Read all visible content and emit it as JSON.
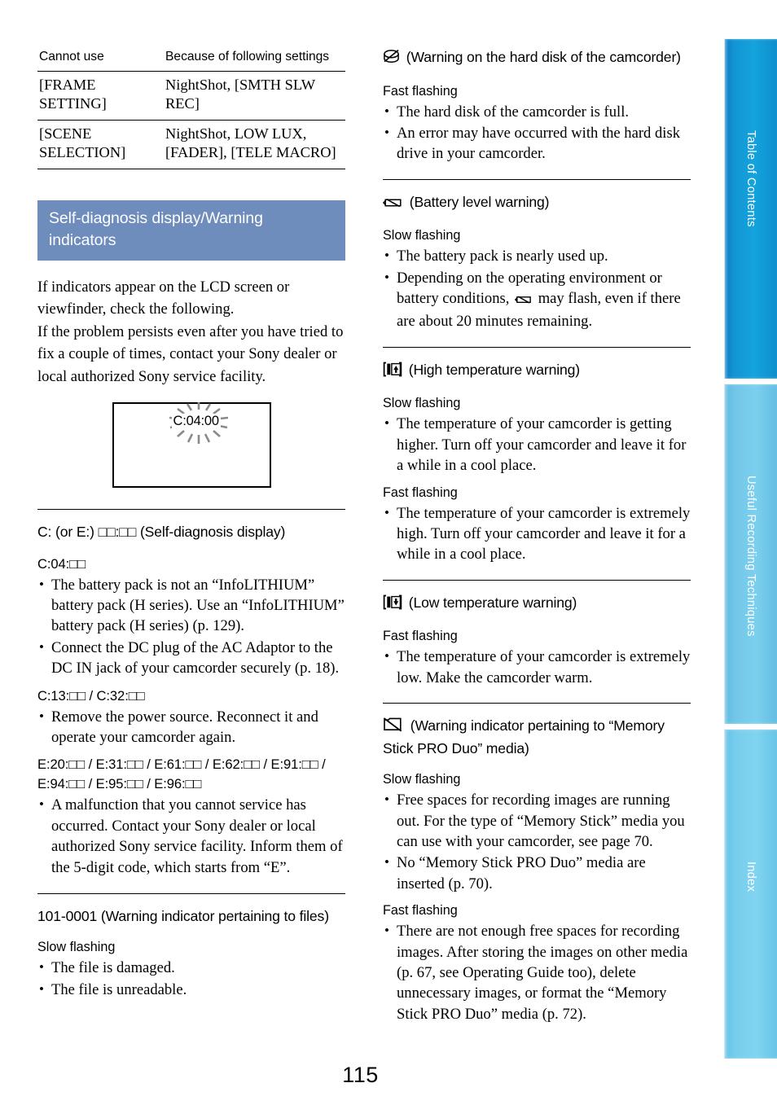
{
  "page": {
    "number": "115"
  },
  "settings_table": {
    "headers": [
      "Cannot use",
      "Because of following settings"
    ],
    "rows": [
      {
        "cannot_use": "[FRAME SETTING]",
        "because": "NightShot, [SMTH SLW REC]"
      },
      {
        "cannot_use": "[SCENE SELECTION]",
        "because": "NightShot, LOW LUX, [FADER], [TELE MACRO]"
      }
    ]
  },
  "section": {
    "title": "Self-diagnosis display/Warning indicators",
    "title_color": "#6e8cbc",
    "intro": [
      "If indicators appear on the LCD screen or viewfinder, check the following.",
      "If the problem persists even after you have tried to fix a couple of times, contact your Sony dealer or local authorized Sony service facility."
    ]
  },
  "illustration": {
    "name": "lcd-screen-illustration",
    "code_display": "C:04:00"
  },
  "left_entries": [
    {
      "heading": "C: (or E:) □□:□□ (Self-diagnosis display)",
      "groups": [
        {
          "code": "C:04:□□",
          "bullets": [
            "The battery pack is not an “InfoLITHIUM” battery pack (H series). Use an “InfoLITHIUM” battery pack (H series) (p. 129).",
            "Connect the DC plug of the AC Adaptor to the DC IN jack of your camcorder securely (p. 18)."
          ]
        },
        {
          "code": "C:13:□□ / C:32:□□",
          "bullets": [
            "Remove the power source. Reconnect it and operate your camcorder again."
          ]
        },
        {
          "code": "E:20:□□ / E:31:□□ / E:61:□□ / E:62:□□ / E:91:□□ / E:94:□□ / E:95:□□ / E:96:□□",
          "bullets": [
            "A malfunction that you cannot service has occurred. Contact your Sony dealer or local authorized Sony service facility. Inform them of the 5-digit code, which starts from “E”."
          ]
        }
      ]
    },
    {
      "heading": "101-0001 (Warning indicator pertaining to files)",
      "groups": [
        {
          "flash": "Slow flashing",
          "bullets": [
            "The file is damaged.",
            "The file is unreadable."
          ]
        }
      ]
    }
  ],
  "right_entries": [
    {
      "icon": "hard-disk-warning-icon",
      "heading": "(Warning on the hard disk of the camcorder)",
      "groups": [
        {
          "flash": "Fast flashing",
          "bullets": [
            "The hard disk of the camcorder is full.",
            "An error may have occurred with the hard disk drive in your camcorder."
          ]
        }
      ]
    },
    {
      "icon": "battery-level-warning-icon",
      "heading": "(Battery level warning)",
      "groups": [
        {
          "flash": "Slow flashing",
          "bullets": [
            "The battery pack is nearly used up.",
            "Depending on the operating environment or battery conditions,  may flash, even if there are about 20 minutes remaining."
          ]
        }
      ]
    },
    {
      "icon": "high-temperature-warning-icon",
      "heading": "(High temperature warning)",
      "groups": [
        {
          "flash": "Slow flashing",
          "bullets": [
            "The temperature of your camcorder is getting higher. Turn off your camcorder and leave it for a while in a cool place."
          ]
        },
        {
          "flash": "Fast flashing",
          "bullets": [
            "The temperature of your camcorder is extremely high. Turn off your camcorder and leave it for a while in a cool place."
          ]
        }
      ]
    },
    {
      "icon": "low-temperature-warning-icon",
      "heading": "(Low temperature warning)",
      "groups": [
        {
          "flash": "Fast flashing",
          "bullets": [
            "The temperature of your camcorder is extremely low. Make the camcorder warm."
          ]
        }
      ]
    },
    {
      "icon": "memory-stick-warning-icon",
      "heading": "(Warning indicator pertaining to “Memory Stick PRO Duo” media)",
      "groups": [
        {
          "flash": "Slow flashing",
          "bullets": [
            "Free spaces for recording images are running out. For the type of “Memory Stick” media you can use with your camcorder, see page 70.",
            "No “Memory Stick PRO Duo” media are inserted (p. 70)."
          ]
        },
        {
          "flash": "Fast flashing",
          "bullets": [
            "There are not enough free spaces for recording images. After storing the images on other media (p. 67, see Operating Guide too), delete unnecessary images, or format the “Memory Stick PRO Duo” media (p. 72)."
          ]
        }
      ]
    }
  ],
  "battery_inline_bullet": {
    "part1": "Depending on the operating environment or battery conditions, ",
    "part2": " may flash, even if there are about 20 minutes remaining."
  },
  "sidebar": {
    "tabs": [
      {
        "label": "Table of Contents",
        "active": true,
        "color": "#14a3dd"
      },
      {
        "label": "Useful Recording Techniques",
        "active": false,
        "color": "#7cd0ee"
      },
      {
        "label": "Index",
        "active": false,
        "color": "#80d4f0"
      }
    ]
  }
}
